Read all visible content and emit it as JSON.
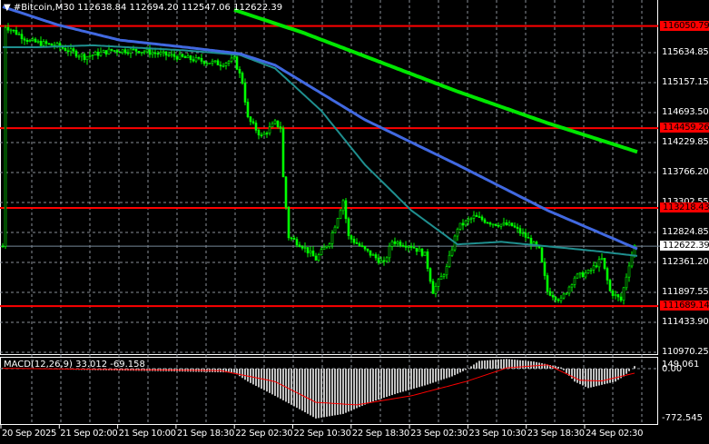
{
  "header": {
    "arrow": "▼",
    "symbol": "#Bitcoin,M30",
    "open": "112638.84",
    "high": "112694.20",
    "low": "112547.06",
    "close": "112622.39"
  },
  "price_axis": [
    "115634.85",
    "115157.15",
    "114693.50",
    "114229.85",
    "113766.20",
    "113302.55",
    "112824.85",
    "112361.20",
    "111897.55",
    "111433.90",
    "110970.25"
  ],
  "levels": [
    {
      "label": "116050.79",
      "price": 116050.79
    },
    {
      "label": "114459.26",
      "price": 114459.26
    },
    {
      "label": "113218.43",
      "price": 113218.43
    },
    {
      "label": "111689.14",
      "price": 111689.14
    }
  ],
  "current_price": {
    "label": "112622.39",
    "price": 112622.39
  },
  "time_axis": [
    "20 Sep 2025",
    "21 Sep 02:00",
    "21 Sep 10:00",
    "21 Sep 18:30",
    "22 Sep 02:30",
    "22 Sep 10:30",
    "22 Sep 18:30",
    "23 Sep 02:30",
    "23 Sep 10:30",
    "23 Sep 18:30",
    "24 Sep 02:30"
  ],
  "macd": {
    "label": "MACD(12,26,9) 33.012 -69.158",
    "axis_top": "149.061",
    "axis_zero": "0.00",
    "axis_bottom": "-772.545",
    "histogram": [
      [
        0,
        10
      ],
      [
        30,
        -20
      ],
      [
        60,
        -40
      ],
      [
        85,
        -60
      ],
      [
        90,
        -200
      ],
      [
        100,
        -420
      ],
      [
        110,
        -650
      ],
      [
        115,
        -770
      ],
      [
        125,
        -700
      ],
      [
        135,
        -520
      ],
      [
        145,
        -380
      ],
      [
        155,
        -260
      ],
      [
        165,
        -120
      ],
      [
        170,
        -20
      ],
      [
        175,
        120
      ],
      [
        185,
        150
      ],
      [
        195,
        110
      ],
      [
        205,
        20
      ],
      [
        210,
        -200
      ],
      [
        215,
        -300
      ],
      [
        225,
        -200
      ],
      [
        228,
        -120
      ],
      [
        232,
        40
      ]
    ],
    "signal": [
      [
        0,
        5
      ],
      [
        80,
        -30
      ],
      [
        100,
        -200
      ],
      [
        115,
        -520
      ],
      [
        130,
        -560
      ],
      [
        150,
        -420
      ],
      [
        170,
        -200
      ],
      [
        185,
        10
      ],
      [
        200,
        60
      ],
      [
        212,
        -180
      ],
      [
        220,
        -190
      ],
      [
        232,
        -70
      ]
    ]
  },
  "colors": {
    "bull": "#00ff00",
    "ma_slow": "#00e600",
    "ma_mid": "#4169e1",
    "ma_fast": "#1f8f8f",
    "level": "#ff0000",
    "grid": "#8a8f99",
    "macd_hist": "#c0c0c0",
    "macd_signal": "#ff0000"
  },
  "price_path": [
    [
      1,
      116050
    ],
    [
      10,
      115810
    ],
    [
      20,
      115740
    ],
    [
      30,
      115570
    ],
    [
      40,
      115670
    ],
    [
      50,
      115670
    ],
    [
      60,
      115600
    ],
    [
      70,
      115530
    ],
    [
      80,
      115460
    ],
    [
      85,
      115530
    ],
    [
      88,
      115180
    ],
    [
      90,
      114610
    ],
    [
      95,
      114330
    ],
    [
      100,
      114540
    ],
    [
      102,
      114470
    ],
    [
      103,
      113690
    ],
    [
      105,
      112770
    ],
    [
      110,
      112630
    ],
    [
      115,
      112420
    ],
    [
      120,
      112700
    ],
    [
      125,
      113340
    ],
    [
      127,
      112770
    ],
    [
      133,
      112560
    ],
    [
      140,
      112350
    ],
    [
      143,
      112700
    ],
    [
      150,
      112630
    ],
    [
      155,
      112490
    ],
    [
      158,
      111920
    ],
    [
      163,
      112280
    ],
    [
      167,
      112910
    ],
    [
      173,
      113080
    ],
    [
      180,
      112980
    ],
    [
      187,
      112940
    ],
    [
      192,
      112770
    ],
    [
      197,
      112560
    ],
    [
      200,
      111920
    ],
    [
      205,
      111780
    ],
    [
      210,
      112140
    ],
    [
      215,
      112210
    ],
    [
      220,
      112420
    ],
    [
      223,
      111920
    ],
    [
      227,
      111780
    ],
    [
      230,
      112350
    ],
    [
      232,
      112622
    ]
  ],
  "ma_slow": [
    [
      85,
      116300
    ],
    [
      110,
      115950
    ],
    [
      167,
      115030
    ],
    [
      200,
      114540
    ],
    [
      233,
      114090
    ]
  ],
  "ma_mid": [
    [
      0,
      116350
    ],
    [
      20,
      116070
    ],
    [
      43,
      115830
    ],
    [
      67,
      115720
    ],
    [
      87,
      115620
    ],
    [
      100,
      115440
    ],
    [
      133,
      114590
    ],
    [
      167,
      113890
    ],
    [
      200,
      113180
    ],
    [
      233,
      112580
    ]
  ],
  "ma_fast": [
    [
      0,
      115720
    ],
    [
      13,
      115720
    ],
    [
      33,
      115750
    ],
    [
      67,
      115670
    ],
    [
      87,
      115600
    ],
    [
      100,
      115390
    ],
    [
      117,
      114730
    ],
    [
      133,
      113890
    ],
    [
      150,
      113180
    ],
    [
      167,
      112650
    ],
    [
      183,
      112690
    ],
    [
      200,
      112620
    ],
    [
      217,
      112550
    ],
    [
      233,
      112470
    ]
  ]
}
